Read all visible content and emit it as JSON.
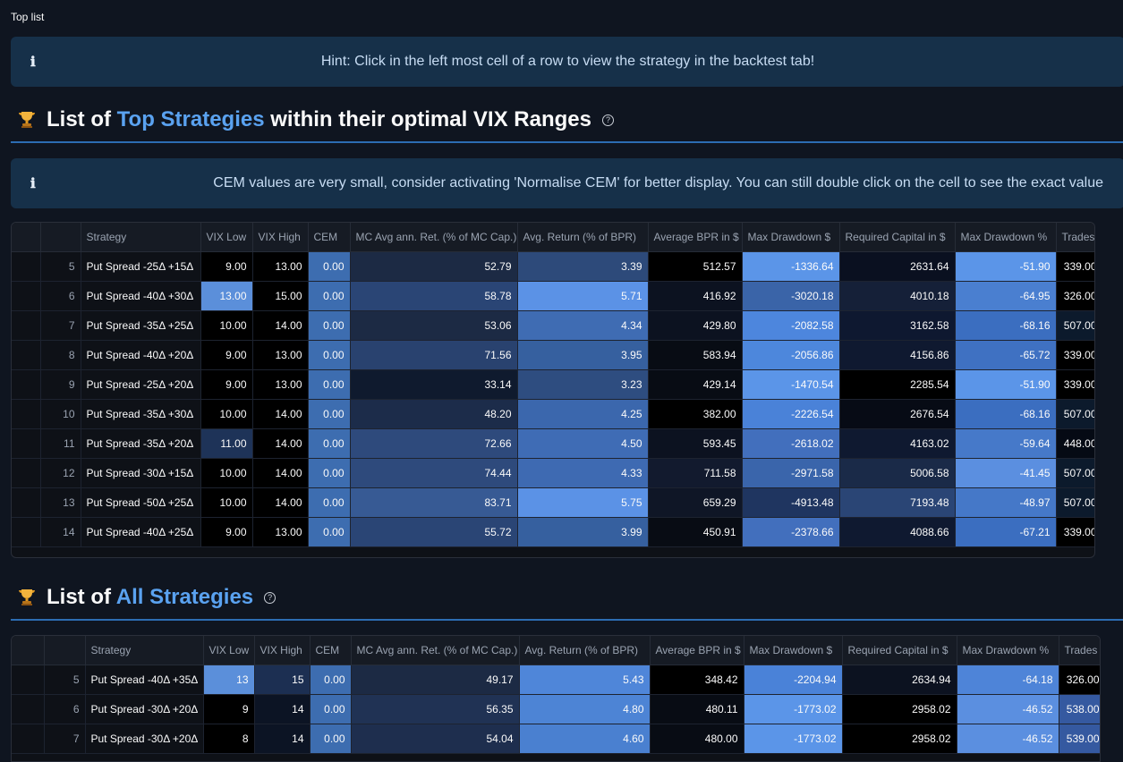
{
  "page": {
    "top_label": "Top list"
  },
  "hint": {
    "icon": "info-icon",
    "text": "Hint: Click in the left most cell of a row to view the strategy in the backtest tab!"
  },
  "section1": {
    "title_pre": "List of ",
    "title_hl": "Top Strategies",
    "title_post": " within their optimal VIX Ranges",
    "accent": "#5aa2f0"
  },
  "cem_notice": {
    "icon": "info-icon",
    "text": "CEM values are very small, consider activating 'Normalise CEM' for better display. You can still double click on the cell to see the exact value"
  },
  "columns": [
    "Strategy",
    "VIX Low",
    "VIX High",
    "CEM",
    "MC Avg ann. Ret. (% of MC Cap.)",
    "Avg. Return (% of BPR)",
    "Average BPR in $",
    "Max Drawdown $",
    "Required Capital in $",
    "Max Drawdown %",
    "Trades"
  ],
  "table1": {
    "rows": [
      {
        "idx": "5",
        "cells": [
          "Put Spread -25Δ +15Δ",
          "9.00",
          "13.00",
          "0.00",
          "52.79",
          "3.39",
          "512.57",
          "-1336.64",
          "2631.64",
          "-51.90",
          "339.00"
        ]
      },
      {
        "idx": "6",
        "cells": [
          "Put Spread -40Δ +30Δ",
          "13.00",
          "15.00",
          "0.00",
          "58.78",
          "5.71",
          "416.92",
          "-3020.18",
          "4010.18",
          "-64.95",
          "326.00"
        ]
      },
      {
        "idx": "7",
        "cells": [
          "Put Spread -35Δ +25Δ",
          "10.00",
          "14.00",
          "0.00",
          "53.06",
          "4.34",
          "429.80",
          "-2082.58",
          "3162.58",
          "-68.16",
          "507.00"
        ]
      },
      {
        "idx": "8",
        "cells": [
          "Put Spread -40Δ +20Δ",
          "9.00",
          "13.00",
          "0.00",
          "71.56",
          "3.95",
          "583.94",
          "-2056.86",
          "4156.86",
          "-65.72",
          "339.00"
        ]
      },
      {
        "idx": "9",
        "cells": [
          "Put Spread -25Δ +20Δ",
          "9.00",
          "13.00",
          "0.00",
          "33.14",
          "3.23",
          "429.14",
          "-1470.54",
          "2285.54",
          "-51.90",
          "339.00"
        ]
      },
      {
        "idx": "10",
        "cells": [
          "Put Spread -35Δ +30Δ",
          "10.00",
          "14.00",
          "0.00",
          "48.20",
          "4.25",
          "382.00",
          "-2226.54",
          "2676.54",
          "-68.16",
          "507.00"
        ]
      },
      {
        "idx": "11",
        "cells": [
          "Put Spread -35Δ +20Δ",
          "11.00",
          "14.00",
          "0.00",
          "72.66",
          "4.50",
          "593.45",
          "-2618.02",
          "4163.02",
          "-59.64",
          "448.00"
        ]
      },
      {
        "idx": "12",
        "cells": [
          "Put Spread -30Δ +15Δ",
          "10.00",
          "14.00",
          "0.00",
          "74.44",
          "4.33",
          "711.58",
          "-2971.58",
          "5006.58",
          "-41.45",
          "507.00"
        ]
      },
      {
        "idx": "13",
        "cells": [
          "Put Spread -50Δ +25Δ",
          "10.00",
          "14.00",
          "0.00",
          "83.71",
          "5.75",
          "659.29",
          "-4913.48",
          "7193.48",
          "-48.97",
          "507.00"
        ]
      },
      {
        "idx": "14",
        "cells": [
          "Put Spread -40Δ +25Δ",
          "9.00",
          "13.00",
          "0.00",
          "55.72",
          "3.99",
          "450.91",
          "-2378.66",
          "4088.66",
          "-67.21",
          "339.00"
        ]
      }
    ],
    "colors": [
      [
        "#000000",
        "#000000",
        "#3d6db0",
        "#1c2a44",
        "#2d4a7a",
        "#000000",
        "#5b95e8",
        "#0a1020",
        "#5b95e8",
        "#000000"
      ],
      [
        "#5b8fda",
        "#000000",
        "#3d6db0",
        "#2a4575",
        "#5b92e6",
        "#0c1220",
        "#3a64a8",
        "#152038",
        "#4a7fd0",
        "#000000"
      ],
      [
        "#000000",
        "#000000",
        "#3d6db0",
        "#1c2a44",
        "#3f6cb3",
        "#0c1220",
        "#4d86dd",
        "#0e1830",
        "#3b6ec0",
        "#0c1a2c"
      ],
      [
        "#000000",
        "#000000",
        "#3d6db0",
        "#29426f",
        "#36609f",
        "#080c14",
        "#4d87dc",
        "#0f1930",
        "#3f71c2",
        "#000000"
      ],
      [
        "#000000",
        "#000000",
        "#3d6db0",
        "#0f1a2e",
        "#2e4d80",
        "#080c14",
        "#5b95e8",
        "#000000",
        "#5b95e8",
        "#000000"
      ],
      [
        "#000000",
        "#000000",
        "#3d6db0",
        "#1c2c4a",
        "#3b67ad",
        "#000000",
        "#4a82d8",
        "#070b15",
        "#3b6ec0",
        "#0c1a2c"
      ],
      [
        "#1e3358",
        "#000000",
        "#3d6db0",
        "#2e4a7c",
        "#3f6cb5",
        "#0c1220",
        "#426fbd",
        "#0f1930",
        "#4679c9",
        "#050a14"
      ],
      [
        "#000000",
        "#000000",
        "#3d6db0",
        "#2e4a7c",
        "#3e6ab2",
        "#121a2e",
        "#3a65ab",
        "#1a2a48",
        "#5b8fe0",
        "#0c1a2c"
      ],
      [
        "#000000",
        "#000000",
        "#3d6db0",
        "#375a94",
        "#5b92e6",
        "#0f1626",
        "#1f3560",
        "#2a4575",
        "#4578c8",
        "#0c1a2c"
      ],
      [
        "#000000",
        "#000000",
        "#3d6db0",
        "#2a4575",
        "#36609f",
        "#080c14",
        "#426fbd",
        "#0f1930",
        "#3b6ec0",
        "#000000"
      ]
    ]
  },
  "section2": {
    "title_pre": "List of ",
    "title_hl": "All Strategies",
    "title_post": ""
  },
  "table2": {
    "rows": [
      {
        "idx": "5",
        "cells": [
          "Put Spread -40Δ +35Δ",
          "13",
          "15",
          "0.00",
          "49.17",
          "5.43",
          "348.42",
          "-2204.94",
          "2634.94",
          "-64.18",
          "326.00"
        ]
      },
      {
        "idx": "6",
        "cells": [
          "Put Spread -30Δ +20Δ",
          "9",
          "14",
          "0.00",
          "56.35",
          "4.80",
          "480.11",
          "-1773.02",
          "2958.02",
          "-46.52",
          "538.00"
        ]
      },
      {
        "idx": "7",
        "cells": [
          "Put Spread -30Δ +20Δ",
          "8",
          "14",
          "0.00",
          "54.04",
          "4.60",
          "480.00",
          "-1773.02",
          "2958.02",
          "-46.52",
          "539.00"
        ]
      }
    ],
    "colors": [
      [
        "#5b8fda",
        "#1c2f52",
        "#3d6db0",
        "#1c2a44",
        "#4f86d9",
        "#000000",
        "#4a82d8",
        "#0c1220",
        "#4e84d8",
        "#000000"
      ],
      [
        "#000000",
        "#0c1424",
        "#3d6db0",
        "#203254",
        "#4d84d5",
        "#080c14",
        "#5b95e8",
        "#000000",
        "#5b8fe0",
        "#3559a0"
      ],
      [
        "#000000",
        "#0c1424",
        "#3d6db0",
        "#1e2e4e",
        "#4a80d0",
        "#080c14",
        "#5b95e8",
        "#000000",
        "#5b8fe0",
        "#3559a0"
      ]
    ]
  }
}
